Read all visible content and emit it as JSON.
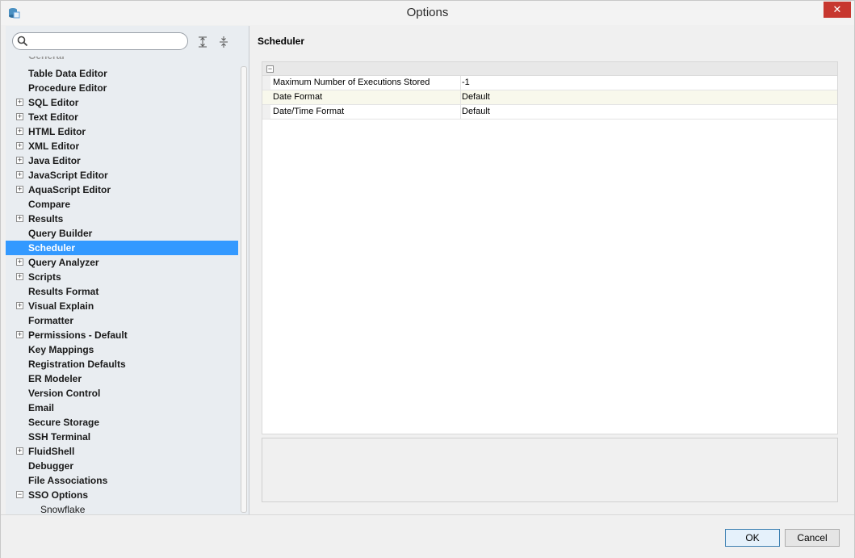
{
  "window": {
    "title": "Options",
    "close_glyph": "✕"
  },
  "search": {
    "placeholder": "",
    "value": ""
  },
  "tree": {
    "items": [
      {
        "label": "General",
        "expander": ""
      },
      {
        "label": "Table Data Editor",
        "expander": ""
      },
      {
        "label": "Procedure Editor",
        "expander": ""
      },
      {
        "label": "SQL Editor",
        "expander": "+"
      },
      {
        "label": "Text Editor",
        "expander": "+"
      },
      {
        "label": "HTML Editor",
        "expander": "+"
      },
      {
        "label": "XML Editor",
        "expander": "+"
      },
      {
        "label": "Java Editor",
        "expander": "+"
      },
      {
        "label": "JavaScript Editor",
        "expander": "+"
      },
      {
        "label": "AquaScript Editor",
        "expander": "+"
      },
      {
        "label": "Compare",
        "expander": ""
      },
      {
        "label": "Results",
        "expander": "+"
      },
      {
        "label": "Query Builder",
        "expander": ""
      },
      {
        "label": "Scheduler",
        "expander": ""
      },
      {
        "label": "Query Analyzer",
        "expander": "+"
      },
      {
        "label": "Scripts",
        "expander": "+"
      },
      {
        "label": "Results Format",
        "expander": ""
      },
      {
        "label": "Visual Explain",
        "expander": "+"
      },
      {
        "label": "Formatter",
        "expander": ""
      },
      {
        "label": "Permissions - Default",
        "expander": "+"
      },
      {
        "label": "Key Mappings",
        "expander": ""
      },
      {
        "label": "Registration Defaults",
        "expander": ""
      },
      {
        "label": "ER Modeler",
        "expander": ""
      },
      {
        "label": "Version Control",
        "expander": ""
      },
      {
        "label": "Email",
        "expander": ""
      },
      {
        "label": "Secure Storage",
        "expander": ""
      },
      {
        "label": "SSH Terminal",
        "expander": ""
      },
      {
        "label": "FluidShell",
        "expander": "+"
      },
      {
        "label": "Debugger",
        "expander": ""
      },
      {
        "label": "File Associations",
        "expander": ""
      },
      {
        "label": "SSO Options",
        "expander": "−"
      },
      {
        "label": "Snowflake",
        "expander": ""
      }
    ],
    "selected": "Scheduler"
  },
  "panel": {
    "title": "Scheduler",
    "group_toggle": "−",
    "rows": [
      {
        "key": "Maximum Number of Executions Stored",
        "value": "-1"
      },
      {
        "key": "Date Format",
        "value": "Default"
      },
      {
        "key": "Date/Time Format",
        "value": "Default"
      }
    ]
  },
  "footer": {
    "ok_label": "OK",
    "cancel_label": "Cancel"
  },
  "colors": {
    "selection": "#3399ff",
    "close_button": "#c7372f",
    "highlight_row": "#f8f8ec"
  },
  "icons": [
    "app-icon",
    "search-icon",
    "expand-all-icon",
    "collapse-all-icon",
    "close-icon"
  ]
}
